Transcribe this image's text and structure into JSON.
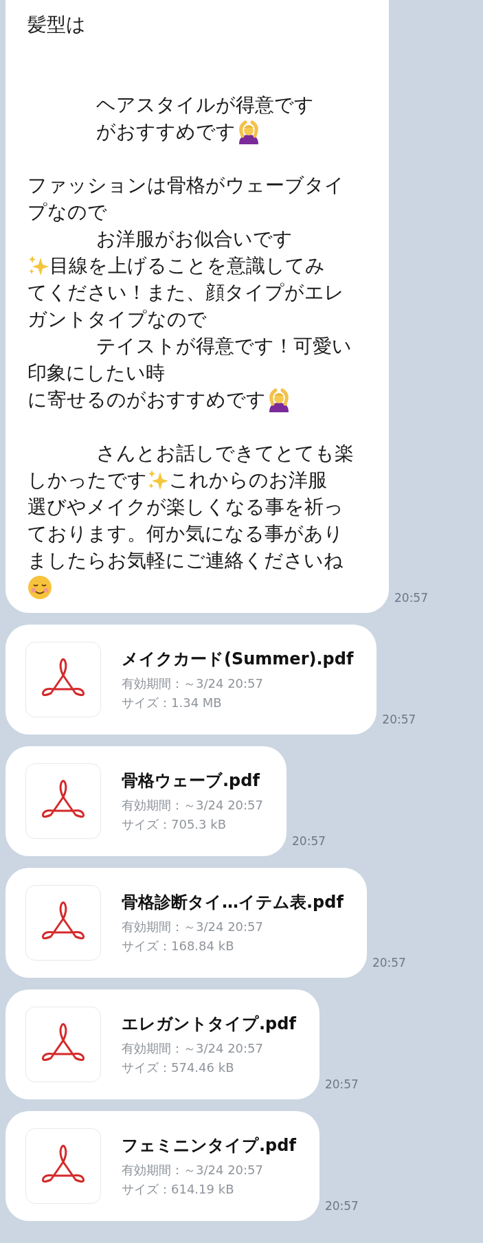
{
  "message": {
    "lines": [
      {
        "kind": "text",
        "masked": false,
        "parts": [
          {
            "kind": "text",
            "text": "髪型は"
          }
        ]
      },
      {
        "kind": "blank"
      },
      {
        "kind": "blank"
      },
      {
        "kind": "text",
        "masked": true,
        "parts": [
          {
            "kind": "text",
            "text": "ヘアスタイルが得意です"
          }
        ]
      },
      {
        "kind": "text",
        "masked": true,
        "parts": [
          {
            "kind": "text",
            "text": "がおすすめです"
          },
          {
            "kind": "gesture"
          }
        ]
      },
      {
        "kind": "blank"
      },
      {
        "kind": "text",
        "masked": false,
        "parts": [
          {
            "kind": "text",
            "text": "ファッションは骨格がウェーブタイ"
          }
        ]
      },
      {
        "kind": "text",
        "masked": false,
        "parts": [
          {
            "kind": "text",
            "text": "プなので"
          }
        ]
      },
      {
        "kind": "text",
        "masked": true,
        "parts": [
          {
            "kind": "text",
            "text": "お洋服がお似合いです"
          }
        ]
      },
      {
        "kind": "text",
        "masked": false,
        "parts": [
          {
            "kind": "sparkle"
          },
          {
            "kind": "text",
            "text": "目線を上げることを意識してみ"
          }
        ]
      },
      {
        "kind": "text",
        "masked": false,
        "parts": [
          {
            "kind": "text",
            "text": "てください！また、顔タイプがエレ"
          }
        ]
      },
      {
        "kind": "text",
        "masked": false,
        "parts": [
          {
            "kind": "text",
            "text": "ガントタイプなので"
          }
        ]
      },
      {
        "kind": "text",
        "masked": true,
        "parts": [
          {
            "kind": "text",
            "text": "テイストが得意です！可愛い"
          }
        ]
      },
      {
        "kind": "text",
        "masked": false,
        "parts": [
          {
            "kind": "text",
            "text": "印象にしたい時"
          }
        ]
      },
      {
        "kind": "text",
        "masked": false,
        "parts": [
          {
            "kind": "text",
            "text": "に寄せるのがおすすめです"
          },
          {
            "kind": "gesture"
          }
        ]
      },
      {
        "kind": "blank"
      },
      {
        "kind": "text",
        "masked": true,
        "parts": [
          {
            "kind": "text",
            "text": "さんとお話しできてとても楽"
          }
        ]
      },
      {
        "kind": "text",
        "masked": false,
        "parts": [
          {
            "kind": "text",
            "text": "しかったです"
          },
          {
            "kind": "sparkle"
          },
          {
            "kind": "text",
            "text": "これからのお洋服"
          }
        ]
      },
      {
        "kind": "text",
        "masked": false,
        "parts": [
          {
            "kind": "text",
            "text": "選びやメイクが楽しくなる事を祈っ"
          }
        ]
      },
      {
        "kind": "text",
        "masked": false,
        "parts": [
          {
            "kind": "text",
            "text": "ております。何か気になる事があり"
          }
        ]
      },
      {
        "kind": "text",
        "masked": false,
        "parts": [
          {
            "kind": "text",
            "text": "ましたらお気軽にご連絡くださいね"
          }
        ]
      },
      {
        "kind": "text",
        "masked": false,
        "parts": [
          {
            "kind": "smile"
          }
        ]
      }
    ],
    "time": "20:57"
  },
  "files": [
    {
      "name": "メイクカード(Summer).pdf",
      "expiry": "有効期間：～3/24 20:57",
      "size": "サイズ：1.34 MB",
      "time": "20:57"
    },
    {
      "name": "骨格ウェーブ.pdf",
      "expiry": "有効期間：～3/24 20:57",
      "size": "サイズ：705.3 kB",
      "time": "20:57"
    },
    {
      "name": "骨格診断タイ…イテム表.pdf",
      "expiry": "有効期間：～3/24 20:57",
      "size": "サイズ：168.84 kB",
      "time": "20:57"
    },
    {
      "name": "エレガントタイプ.pdf",
      "expiry": "有効期間：～3/24 20:57",
      "size": "サイズ：574.46 kB",
      "time": "20:57"
    },
    {
      "name": "フェミニンタイプ.pdf",
      "expiry": "有効期間：～3/24 20:57",
      "size": "サイズ：614.19 kB",
      "time": "20:57"
    }
  ]
}
